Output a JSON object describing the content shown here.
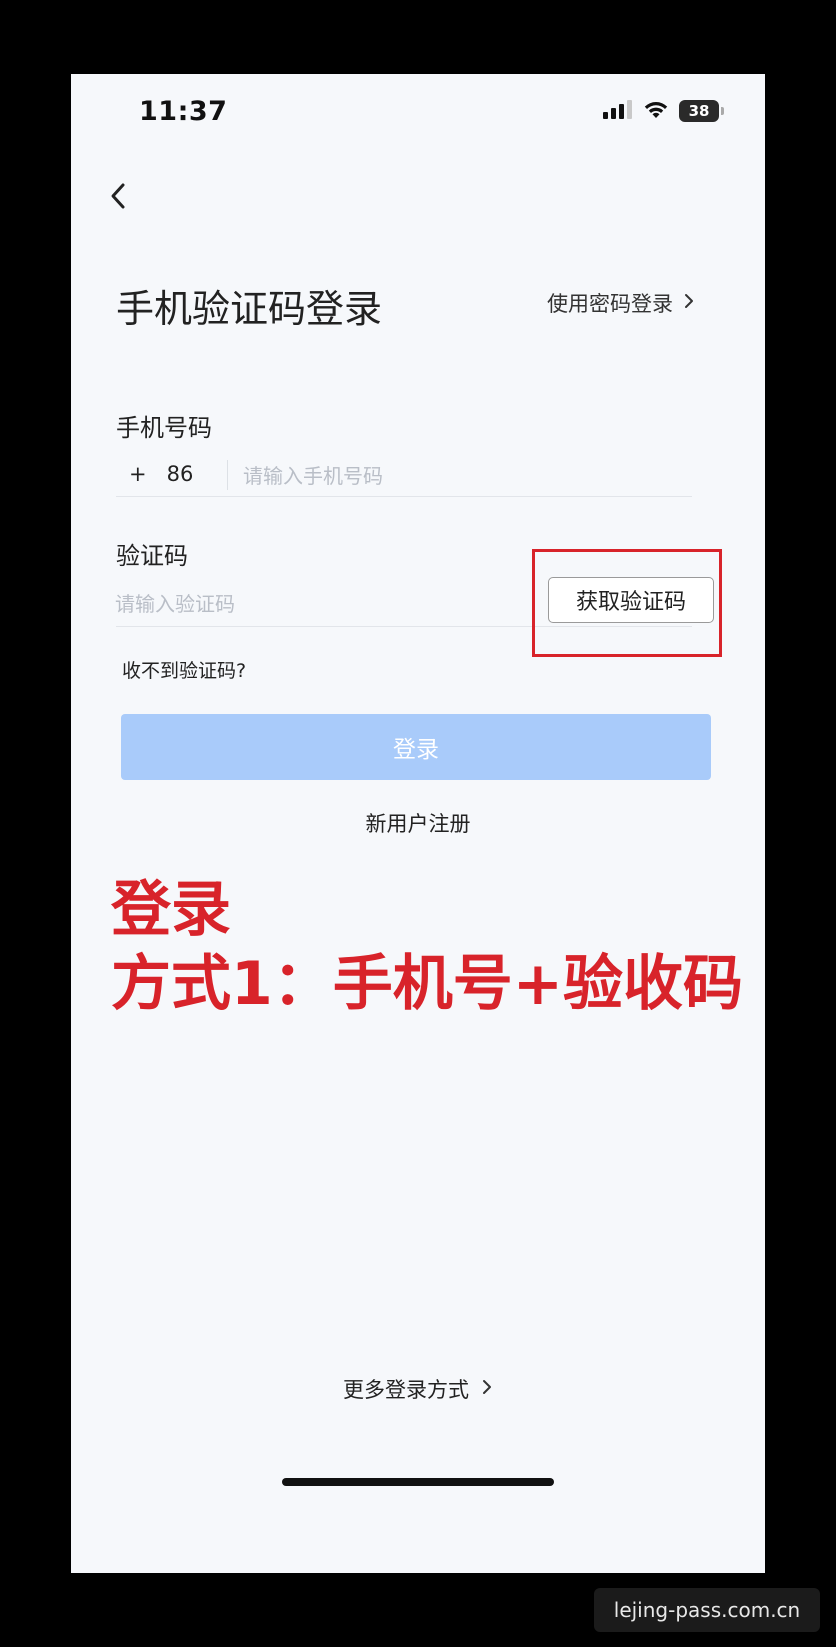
{
  "status_bar": {
    "time": "11:37",
    "battery": "38"
  },
  "header": {
    "title": "手机验证码登录",
    "password_login_link": "使用密码登录"
  },
  "phone_field": {
    "label": "手机号码",
    "country_code_plus": "+",
    "country_code": "86",
    "placeholder": "请输入手机号码",
    "value": ""
  },
  "code_field": {
    "label": "验证码",
    "placeholder": "请输入验证码",
    "value": "",
    "get_code_button": "获取验证码"
  },
  "links": {
    "no_code": "收不到验证码?",
    "register": "新用户注册",
    "more_login": "更多登录方式"
  },
  "login_button": {
    "label": "登录",
    "color": "#a9cbfa"
  },
  "annotation": {
    "line1": "登录",
    "line2": "方式1：手机号+验收码",
    "color": "#d8232a"
  },
  "watermark": "lejing-pass.com.cn",
  "icons": {
    "back": "chevron-left-icon",
    "password_link_arrow": "chevron-right-icon",
    "more_login_arrow": "chevron-right-icon",
    "signal": "cellular-signal-icon",
    "wifi": "wifi-icon",
    "battery": "battery-icon"
  }
}
